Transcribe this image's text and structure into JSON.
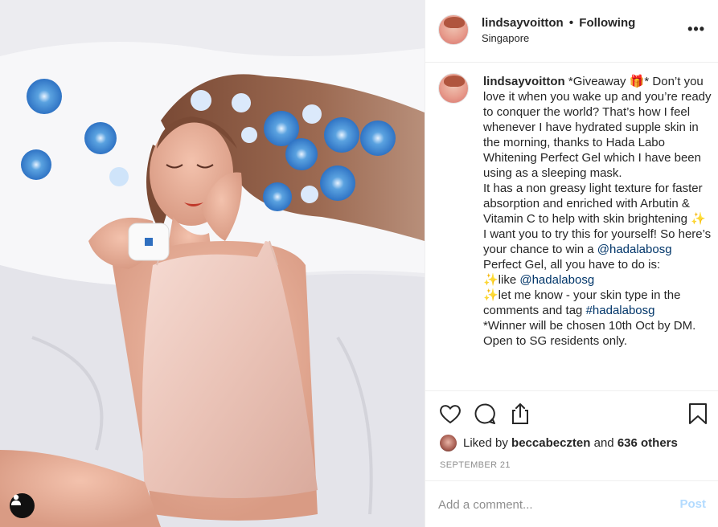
{
  "post": {
    "username": "lindsayvoitton",
    "dot": "•",
    "follow_status": "Following",
    "location": "Singapore",
    "more_icon": "more-horizontal-icon"
  },
  "caption": {
    "username": "lindsayvoitton",
    "segments": [
      {
        "type": "text",
        "text": " *Giveaway 🎁* Don’t you love it when you wake up and you’re ready to conquer the world? That’s how I feel whenever I have hydrated supple skin in the morning, thanks to Hada Labo Whitening Perfect Gel which I have been using as a sleeping mask.\nIt has a non greasy light texture for faster absorption and enriched with Arbutin & Vitamin C to help with skin brightening ✨\nI want you to try this for yourself! So here’s your chance to win a "
      },
      {
        "type": "mention",
        "text": "@hadalabosg"
      },
      {
        "type": "text",
        "text": " Perfect Gel, all you have to do is:\n✨like "
      },
      {
        "type": "mention",
        "text": "@hadalabosg"
      },
      {
        "type": "text",
        "text": "\n✨let me know - your skin type in the comments and tag "
      },
      {
        "type": "mention",
        "text": "#hadalabosg"
      },
      {
        "type": "text",
        "text": "\n*Winner will be chosen 10th Oct by DM.\nOpen to SG residents only."
      }
    ]
  },
  "actions": {
    "icons": [
      "heart-icon",
      "comment-icon",
      "share-icon",
      "bookmark-icon"
    ]
  },
  "likes": {
    "prefix": "Liked by ",
    "liker": "beccabeczten",
    "middle": " and ",
    "others": "636 others"
  },
  "date": "SEPTEMBER 21",
  "comment": {
    "placeholder": "Add a comment...",
    "post_label": "Post"
  },
  "colors": {
    "text": "#262626",
    "mention": "#003569",
    "muted": "#8e8e8e",
    "post_disabled": "#b3dbff",
    "border": "#efefef"
  },
  "photo": {
    "tag_icon": "user-tag-icon"
  }
}
